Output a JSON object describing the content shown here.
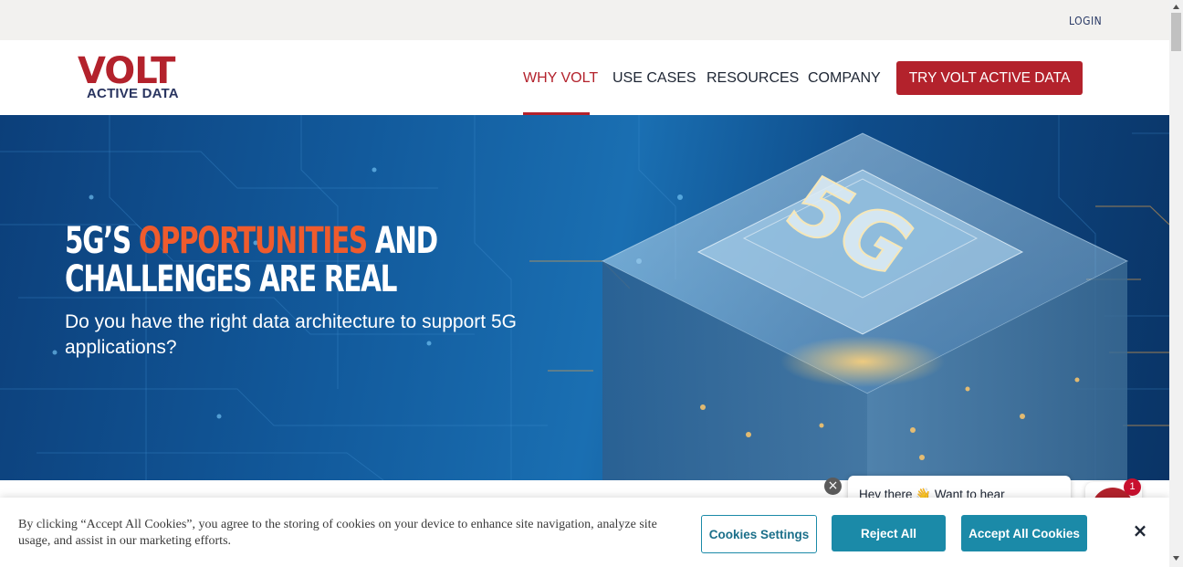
{
  "header": {
    "login_label": "LOGIN"
  },
  "logo": {
    "wordmark": "VOLT",
    "tagline": "ACTIVE DATA"
  },
  "nav": {
    "items": [
      {
        "label": "WHY VOLT",
        "active": true
      },
      {
        "label": "USE CASES",
        "active": false
      },
      {
        "label": "RESOURCES",
        "active": false
      },
      {
        "label": "COMPANY",
        "active": false
      }
    ],
    "cta_label": "TRY VOLT ACTIVE DATA"
  },
  "hero": {
    "title_prefix": "5G’S ",
    "title_highlight": "OPPORTUNITIES",
    "title_suffix": " AND CHALLENGES ARE REAL",
    "subtitle": "Do you have the right data architecture to support 5G applications?",
    "image_label": "5G"
  },
  "chat": {
    "close_label": "×",
    "message_preview": "Hey there 👋 Want to hear",
    "badge_count": "1"
  },
  "cookie_banner": {
    "text": "By clicking “Accept All Cookies”, you agree to the storing of cookies on your device to enhance site navigation, analyze site usage, and assist in our marketing efforts.",
    "settings_label": "Cookies Settings",
    "reject_label": "Reject All",
    "accept_label": "Accept All Cookies",
    "close_label": "×"
  },
  "colors": {
    "brand_red": "#b3222c",
    "brand_navy": "#2a3560",
    "highlight_orange": "#ef5b2d",
    "cookie_teal": "#1b8aa8",
    "topbar_bg": "#f2f1ef"
  }
}
